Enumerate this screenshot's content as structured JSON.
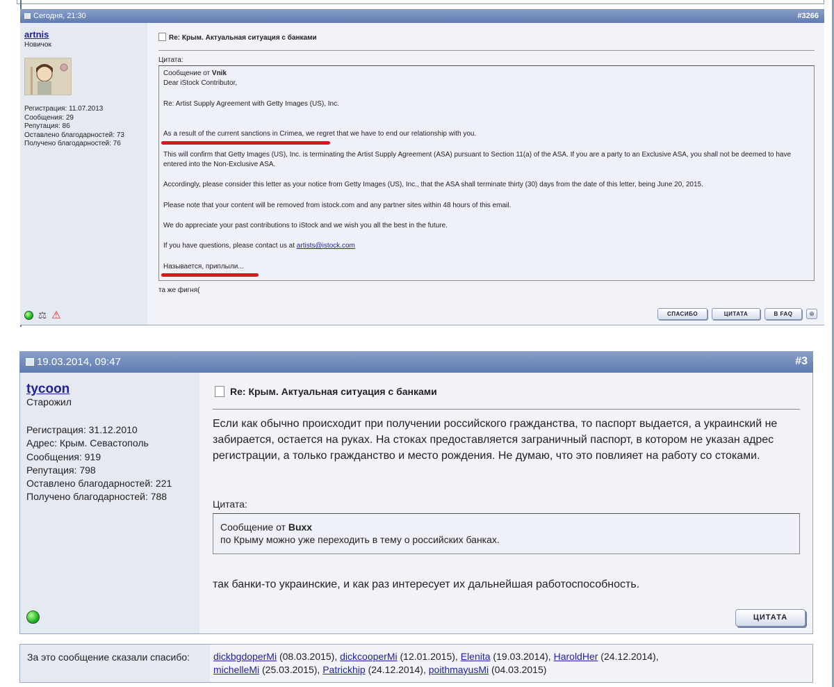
{
  "post1": {
    "date": "Сегодня, 21:30",
    "number": "#3266",
    "username": "artnis",
    "rank": "Новичок",
    "stats": [
      "Регистрация: 11.07.2013",
      "Сообщения: 29",
      "Репутация: 86",
      "Оставлено благодарностей: 73",
      "Получено благодарностей: 76"
    ],
    "title": "Re: Крым. Актуальная ситуация с банками",
    "quote_label": "Цитата:",
    "quote_from_prefix": "Сообщение от",
    "quote_from_user": "Vnik",
    "quote": {
      "greeting": "Dear iStock Contributor,",
      "re": "Re: Artist Supply Agreement with Getty Images (US), Inc.",
      "p1_underlined": "As a result of the current sanctions in Crimea",
      "p1_rest": ", we regret that we have to end our relationship with you.",
      "p2": "This will confirm that Getty Images (US), Inc. is terminating the Artist Supply Agreement (ASA) pursuant to Section 11(a) of the ASA. If you are a party to an Exclusive ASA, you shall not be deemed to have entered into the Non-Exclusive ASA.",
      "p3": "Accordingly, please consider this letter as your notice from Getty Images (US), Inc., that the ASA shall terminate thirty (30) days from the date of this letter, being June 20, 2015.",
      "p4": "Please note that your content will be removed from istock.com and any partner sites within 48 hours of this email.",
      "p5": "We do appreciate your past contributions to iStock and we wish you all the best in the future.",
      "p6_text": "If you have questions, please contact us at",
      "p6_link": "artists@istock.com",
      "p7": "Называется, приплыли..."
    },
    "after_text": "та же фигня(",
    "buttons": {
      "thanks": "СПАСИБО",
      "quote": "ЦИТАТА",
      "faq": "В FAQ"
    }
  },
  "post2": {
    "date": "19.03.2014, 09:47",
    "number": "#3",
    "username": "tycoon",
    "rank": "Старожил",
    "stats": [
      "Регистрация: 31.12.2010",
      "Адрес: Крым. Севастополь",
      "Сообщения: 919",
      "Репутация: 798",
      "Оставлено благодарностей: 221",
      "Получено благодарностей: 788"
    ],
    "title": "Re: Крым. Актуальная ситуация с банками",
    "body": "Если как обычно происходит при получении российского гражданства, то паспорт выдается, а украинский не забирается, остается на руках. На стоках предоставляется заграничный паспорт, в котором не указан адрес регистрации, а только гражданство и место рождения. Не думаю, что это повлияет на работу со стоками.",
    "quote_label": "Цитата:",
    "quote_from_prefix": "Сообщение от",
    "quote_from_user": "Buxx",
    "quote_text": "по Крыму можно уже переходить в тему о российских банках.",
    "after_text": "так банки-то украинские, и как раз интересует их дальнейшая работоспособность.",
    "button_quote": "ЦИТАТА"
  },
  "thanks_bar": {
    "label": "За это сообщение сказали спасибо:",
    "users": [
      {
        "name": "dickbgdoperMi",
        "date": "(08.03.2015),"
      },
      {
        "name": "dickcooperMi",
        "date": "(12.01.2015),"
      },
      {
        "name": "Elenita",
        "date": "(19.03.2014),"
      },
      {
        "name": "HaroldHer",
        "date": "(24.12.2014),"
      },
      {
        "name": "michelleMi",
        "date": "(25.03.2015),"
      },
      {
        "name": "Patrickhip",
        "date": "(24.12.2014),"
      },
      {
        "name": "poithmayusMi",
        "date": "(04.03.2015)"
      }
    ]
  },
  "colors": {
    "header_gradient_top": "#8a9fc9",
    "header_gradient_bottom": "#5f7bb0",
    "sidebar_bg": "#e5e9f2",
    "main_bg": "#f1f3f8",
    "link": "#22229c",
    "highlight_underline": "#e0141c",
    "online_status": "#22b522"
  }
}
